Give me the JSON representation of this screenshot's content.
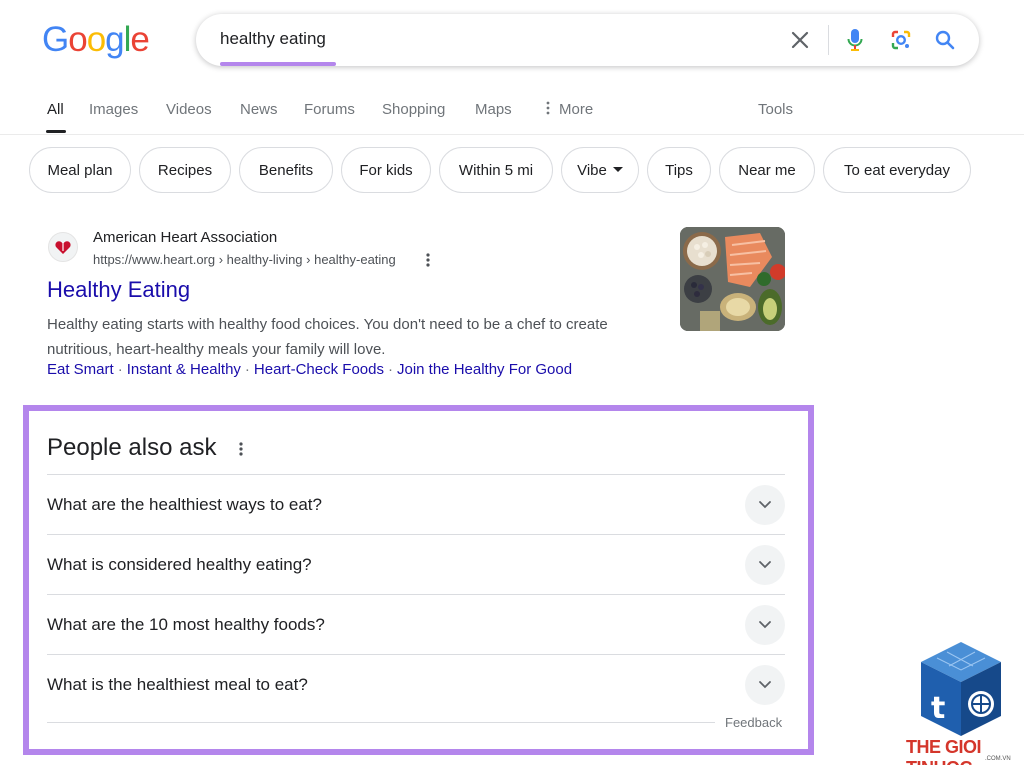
{
  "logo": {
    "letters": [
      {
        "char": "G",
        "color": "#4285F4"
      },
      {
        "char": "o",
        "color": "#EA4335"
      },
      {
        "char": "o",
        "color": "#FBBC05"
      },
      {
        "char": "g",
        "color": "#4285F4"
      },
      {
        "char": "l",
        "color": "#34A853"
      },
      {
        "char": "e",
        "color": "#EA4335"
      }
    ]
  },
  "search": {
    "query": "healthy eating",
    "icons": [
      "clear-icon",
      "microphone-icon",
      "lens-icon",
      "search-icon"
    ],
    "highlight_color": "#b486ec"
  },
  "tabs": [
    {
      "label": "All",
      "active": true
    },
    {
      "label": "Images"
    },
    {
      "label": "Videos"
    },
    {
      "label": "News"
    },
    {
      "label": "Forums"
    },
    {
      "label": "Shopping"
    },
    {
      "label": "Maps"
    },
    {
      "label": "More",
      "icon": "more-vert-icon"
    },
    {
      "label": "Tools"
    }
  ],
  "chips": [
    "Meal plan",
    "Recipes",
    "Benefits",
    "For kids",
    "Within 5 mi",
    "Vibe",
    "Tips",
    "Near me",
    "To eat everyday"
  ],
  "result": {
    "site_name": "American Heart Association",
    "url": "https://www.heart.org › healthy-living › healthy-eating",
    "title": "Healthy Eating",
    "snippet_line1": "Healthy eating starts with healthy food choices. You don't need to be a chef to create",
    "snippet_line2": "nutritious, heart-healthy meals your family will love.",
    "sitelinks": [
      "Eat Smart",
      "Instant & Healthy",
      "Heart-Check Foods",
      "Join the Healthy For Good"
    ],
    "link_color": "#1a0dab"
  },
  "paa": {
    "title": "People also ask",
    "questions": [
      "What are the healthiest ways to eat?",
      "What is considered healthy eating?",
      "What are the 10 most healthy foods?",
      "What is the healthiest meal to eat?"
    ],
    "feedback": "Feedback",
    "frame_color": "#b486ec"
  },
  "watermark": {
    "text": "THE GIOI TINHOC",
    "sub": ".COM.VN",
    "color": "#d4362b"
  }
}
